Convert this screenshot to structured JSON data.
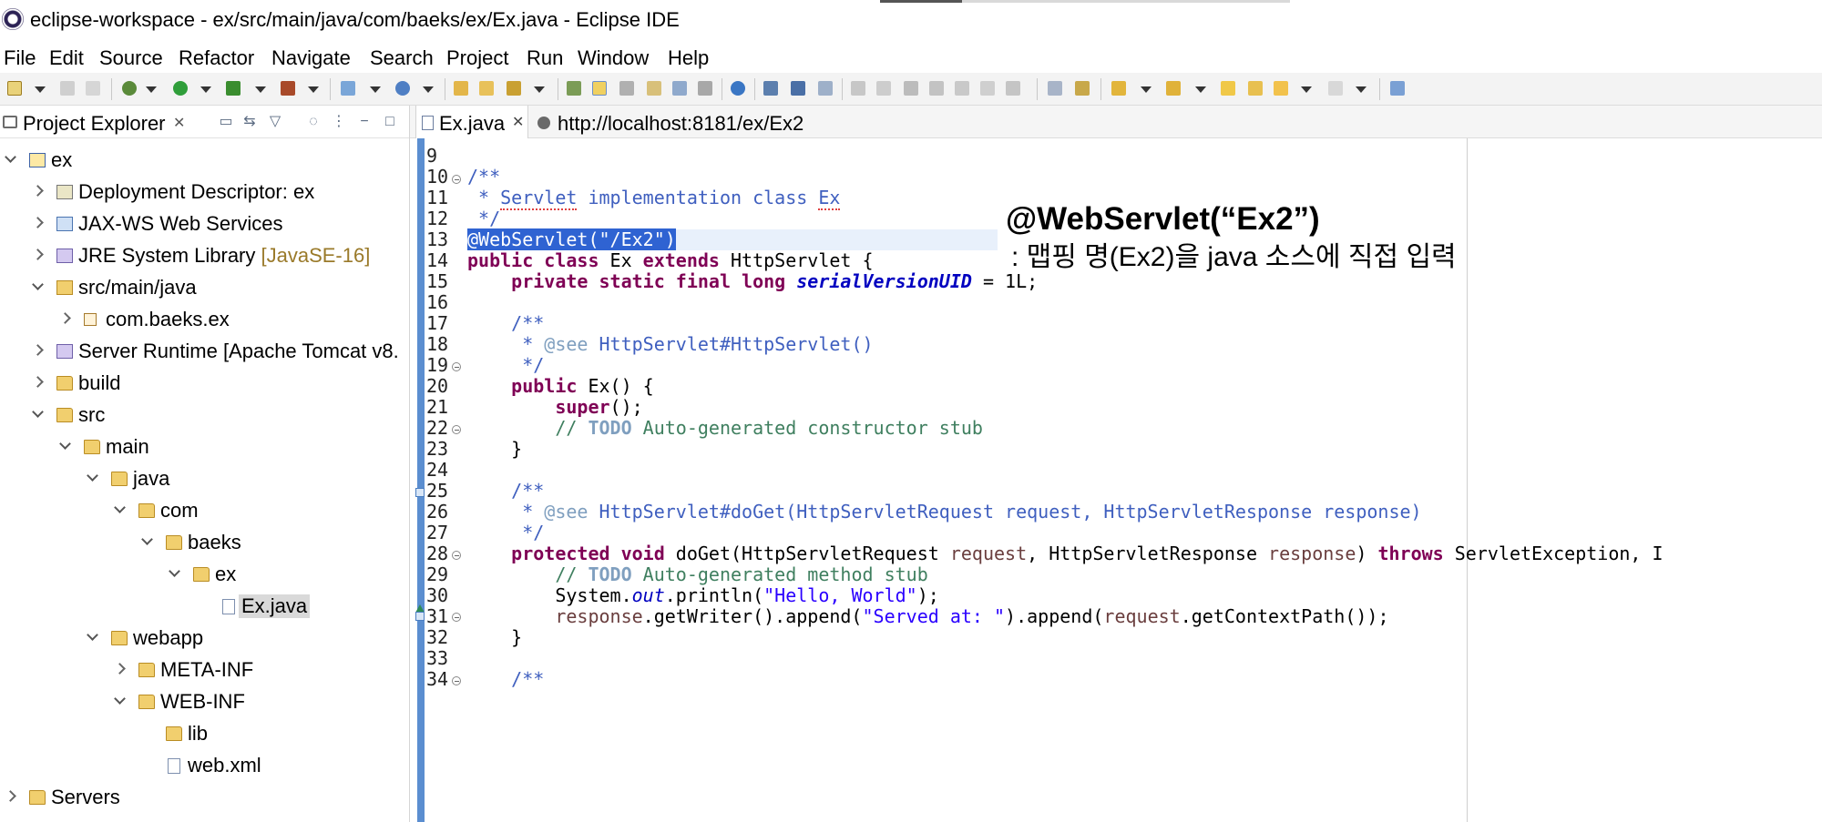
{
  "window": {
    "title": "eclipse-workspace - ex/src/main/java/com/baeks/ex/Ex.java - Eclipse IDE"
  },
  "menu": [
    "File",
    "Edit",
    "Source",
    "Refactor",
    "Navigate",
    "Search",
    "Project",
    "Run",
    "Window",
    "Help"
  ],
  "explorer": {
    "tab_label": "Project Explorer",
    "close_glyph": "✕",
    "tree": [
      {
        "label": "ex",
        "hint": "",
        "icon": "project-icon"
      },
      {
        "label": "Deployment Descriptor: ex",
        "hint": "",
        "icon": "deployment-descriptor-icon"
      },
      {
        "label": "JAX-WS Web Services",
        "hint": "",
        "icon": "web-services-icon"
      },
      {
        "label": "JRE System Library ",
        "hint": "[JavaSE-16]",
        "icon": "library-icon"
      },
      {
        "label": "src/main/java",
        "hint": "",
        "icon": "source-folder-icon"
      },
      {
        "label": "com.baeks.ex",
        "hint": "",
        "icon": "package-icon"
      },
      {
        "label": "Server Runtime [Apache Tomcat v8.",
        "hint": "",
        "icon": "library-icon"
      },
      {
        "label": "build",
        "hint": "",
        "icon": "folder-icon"
      },
      {
        "label": "src",
        "hint": "",
        "icon": "folder-icon"
      },
      {
        "label": "main",
        "hint": "",
        "icon": "folder-icon"
      },
      {
        "label": "java",
        "hint": "",
        "icon": "folder-icon"
      },
      {
        "label": "com",
        "hint": "",
        "icon": "folder-icon"
      },
      {
        "label": "baeks",
        "hint": "",
        "icon": "folder-icon"
      },
      {
        "label": "ex",
        "hint": "",
        "icon": "folder-icon"
      },
      {
        "label": "Ex.java",
        "hint": "",
        "icon": "java-file-icon"
      },
      {
        "label": "webapp",
        "hint": "",
        "icon": "folder-icon"
      },
      {
        "label": "META-INF",
        "hint": "",
        "icon": "folder-icon"
      },
      {
        "label": "WEB-INF",
        "hint": "",
        "icon": "folder-icon"
      },
      {
        "label": "lib",
        "hint": "",
        "icon": "folder-icon"
      },
      {
        "label": "web.xml",
        "hint": "",
        "icon": "xml-file-icon"
      },
      {
        "label": "Servers",
        "hint": "",
        "icon": "folder-icon"
      }
    ]
  },
  "editor": {
    "tabs": [
      {
        "label": "Ex.java",
        "close": "✕",
        "active": true
      },
      {
        "label": "http://localhost:8181/ex/Ex2",
        "close": "",
        "active": false
      }
    ],
    "line_numbers": [
      "9",
      "10",
      "11",
      "12",
      "13",
      "14",
      "15",
      "16",
      "17",
      "18",
      "19",
      "20",
      "21",
      "22",
      "23",
      "24",
      "25",
      "26",
      "27",
      "28",
      "29",
      "30",
      "31",
      "32",
      "33",
      "34"
    ],
    "code": {
      "l10": "/**",
      "l11a": " * ",
      "l11b": "Servlet",
      "l11c": " implementation class ",
      "l11d": "Ex",
      "l12": " */",
      "l13": "@WebServlet(\"/Ex2\")",
      "l14a": "public class",
      "l14b": " Ex ",
      "l14c": "extends",
      "l14d": " HttpServlet {",
      "l15a": "    ",
      "l15b": "private static final long",
      "l15c": " ",
      "l15d": "serialVersionUID",
      "l15e": " = 1L;",
      "l17": "    /**",
      "l18a": "     * ",
      "l18b": "@see",
      "l18c": " HttpServlet#HttpServlet()",
      "l19": "     */",
      "l20a": "    ",
      "l20b": "public",
      "l20c": " Ex() {",
      "l21a": "        ",
      "l21b": "super",
      "l21c": "();",
      "l22a": "        // ",
      "l22b": "TODO",
      "l22c": " Auto-generated constructor stub",
      "l23": "    }",
      "l25": "    /**",
      "l26a": "     * ",
      "l26b": "@see",
      "l26c": " HttpServlet#doGet(HttpServletRequest request, HttpServletResponse response)",
      "l27": "     */",
      "l28a": "    ",
      "l28b": "protected void",
      "l28c": " doGet(HttpServletRequest ",
      "l28d": "request",
      "l28e": ", HttpServletResponse ",
      "l28f": "response",
      "l28g": ") ",
      "l28h": "throws",
      "l28i": " ServletException, I",
      "l29a": "        // ",
      "l29b": "TODO",
      "l29c": " Auto-generated method stub",
      "l30a": "        System.",
      "l30b": "out",
      "l30c": ".println(",
      "l30d": "\"Hello, World\"",
      "l30e": ");",
      "l31a": "        ",
      "l31b": "response",
      "l31c": ".getWriter().append(",
      "l31d": "\"Served at: \"",
      "l31e": ").append(",
      "l31f": "request",
      "l31g": ".getContextPath());",
      "l32": "    }",
      "l34": "    /**"
    }
  },
  "annotation": {
    "title": "@WebServlet(“Ex2”)",
    "description": ": 맵핑 명(Ex2)을 java 소스에 직접 입력"
  }
}
